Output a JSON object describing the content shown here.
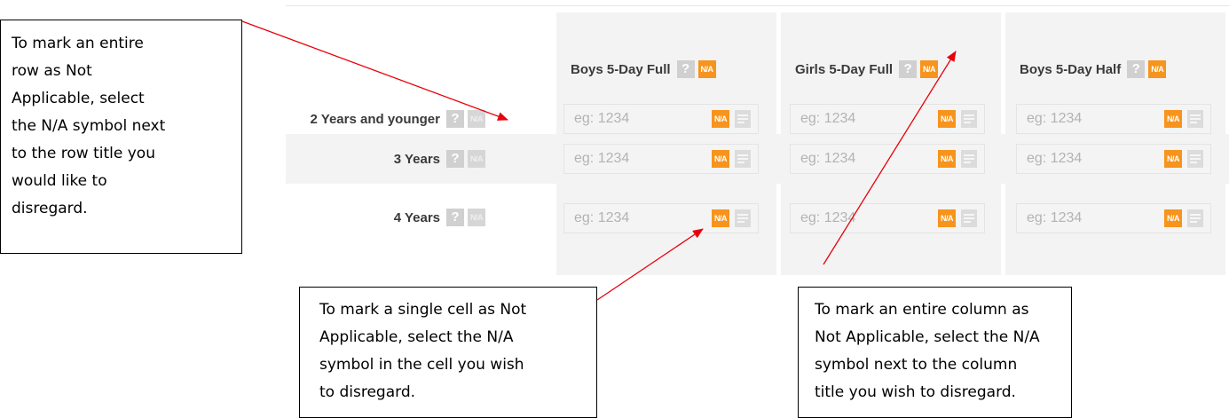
{
  "columns": [
    {
      "title": "Boys 5-Day Full",
      "help": "?",
      "na": "N/A"
    },
    {
      "title": "Girls 5-Day Full",
      "help": "?",
      "na": "N/A"
    },
    {
      "title": "Boys 5-Day Half",
      "help": "?",
      "na": "N/A"
    }
  ],
  "rows": [
    {
      "title": "2 Years and younger",
      "help": "?",
      "na": "N/A",
      "cells": [
        {
          "placeholder": "eg: 1234",
          "na": "N/A"
        },
        {
          "placeholder": "eg: 1234",
          "na": "N/A"
        },
        {
          "placeholder": "eg: 1234",
          "na": "N/A"
        }
      ]
    },
    {
      "title": "3 Years",
      "help": "?",
      "na": "N/A",
      "cells": [
        {
          "placeholder": "eg: 1234",
          "na": "N/A"
        },
        {
          "placeholder": "eg: 1234",
          "na": "N/A"
        },
        {
          "placeholder": "eg: 1234",
          "na": "N/A"
        }
      ]
    },
    {
      "title": "4 Years",
      "help": "?",
      "na": "N/A",
      "cells": [
        {
          "placeholder": "eg: 1234",
          "na": "N/A"
        },
        {
          "placeholder": "eg: 1234",
          "na": "N/A"
        },
        {
          "placeholder": "eg: 1234",
          "na": "N/A"
        }
      ]
    }
  ],
  "callouts": {
    "row": "To mark an entire\nrow as Not\nApplicable, select\nthe N/A symbol next\nto the row title you\nwould like to\ndisregard.",
    "cell": "To mark a single cell as Not\nApplicable, select the N/A\nsymbol in the cell you wish\nto disregard.",
    "column": "To mark an entire column as\nNot Applicable, select the N/A\nsymbol next to the column\ntitle you wish to disregard."
  },
  "colors": {
    "na_active": "#f7941d",
    "na_inactive": "#d6d6d6",
    "arrow": "#e8000b",
    "band": "#f3f3f3"
  }
}
